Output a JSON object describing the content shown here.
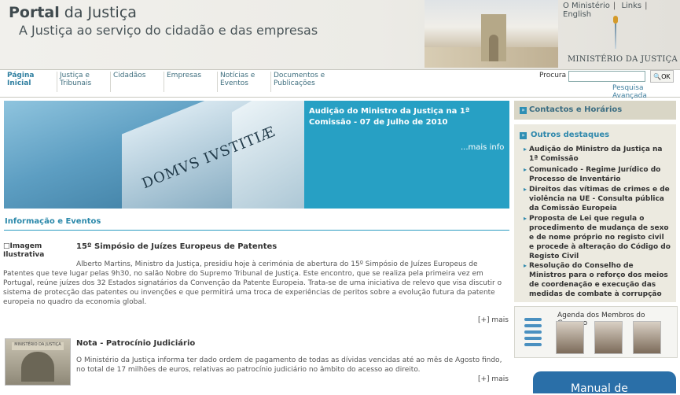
{
  "header": {
    "title_bold": "Portal",
    "title_rest": " da Justiça",
    "subtitle": "A Justiça ao serviço do cidadão e das empresas",
    "ministry_name": "MINISTÉRIO DA JUSTIÇA"
  },
  "top_links": [
    "O Ministério",
    "Links",
    "English"
  ],
  "nav": [
    {
      "label": "Página Inicial",
      "active": true
    },
    {
      "label": "Justiça e Tribunais"
    },
    {
      "label": "Cidadãos"
    },
    {
      "label": "Empresas"
    },
    {
      "label": "Notícias e Eventos"
    },
    {
      "label": "Documentos e Publicações"
    }
  ],
  "search": {
    "label": "Procura",
    "value": "",
    "button_label": "OK",
    "advanced_label": "Pesquisa Avançada"
  },
  "hero": {
    "image_text": "DOMVS IVSTITIÆ",
    "headline": "Audição do Ministro da Justiça na 1ª Comissão - 07 de Julho de 2010",
    "more": "...mais info"
  },
  "section": {
    "title": "Informação e Eventos"
  },
  "news": [
    {
      "image_alt": "Imagem Ilustrativa",
      "title": "15º Simpósio de Juízes Europeus de Patentes",
      "body": "Alberto Martins, Ministro da Justiça, presidiu hoje à cerimónia de abertura do 15º Simpósio de Juízes Europeus de Patentes que teve lugar pelas 9h30, no salão Nobre do Supremo Tribunal de Justiça. Este encontro, que se realiza pela primeira vez em Portugal, reúne juízes dos 32 Estados signatários da Convenção da Patente Europeia. Trata-se de uma iniciativa de relevo que visa discutir o sistema de protecção das patentes ou invenções e que permitirá uma troca de experiências de peritos sobre a evolução futura da patente europeia no quadro da economia global.",
      "more": "[+] mais"
    },
    {
      "image_sign": "MINISTÉRIO DA JUSTIÇA",
      "title": "Nota - Patrocínio Judiciário",
      "body": "O Ministério da Justiça informa ter dado ordem de pagamento de todas as dívidas vencidas até ao mês de Agosto findo, no total de 17 milhões de euros, relativas ao patrocínio judiciário no âmbito do acesso ao direito.",
      "more": "[+] mais"
    }
  ],
  "sidebar": {
    "contacts_label": "Contactos e Horários",
    "destaques_label": "Outros destaques",
    "destaques": [
      "Audição do Ministro da Justiça na 1ª Comissão",
      "Comunicado - Regime Jurídico do Processo de Inventário",
      "Direitos das vítimas de crimes e de violência na UE - Consulta pública da Comissão Europeia",
      "Proposta de Lei que regula o procedimento de mudança de sexo e de nome próprio no registo civil e procede à alteração do Código do Registo Civil",
      "Resolução do Conselho de Ministros para o reforço dos meios de coordenação e execução das medidas de combate à corrupção"
    ],
    "agenda_title": "Agenda dos Membros do Governo",
    "manual_label": "Manual de"
  },
  "colors": {
    "accent": "#2a9cc0",
    "hero_bg": "#27a0c4",
    "sidebar_bg": "#eceae0"
  }
}
